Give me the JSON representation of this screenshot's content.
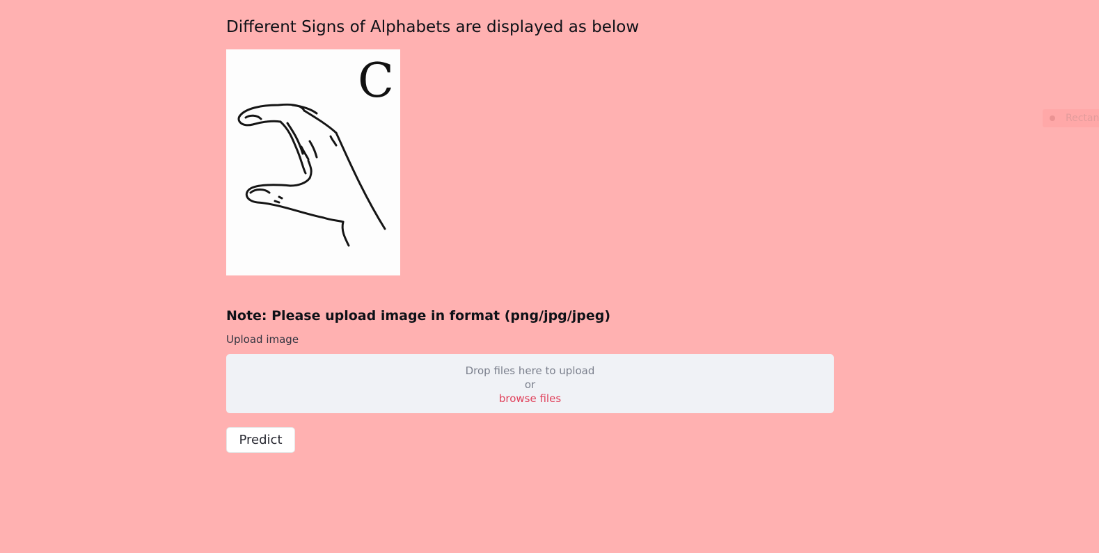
{
  "main": {
    "heading": "Different Signs of Alphabets are displayed as below",
    "sign_image": {
      "letter": "C",
      "icon": "hand-sign-c-illustration"
    },
    "note": "Note: Please upload image in format (png/jpg/jpeg)",
    "uploader": {
      "label": "Upload image",
      "drop_text": "Drop files here to upload",
      "or_text": "or",
      "browse_text": "browse files"
    },
    "predict_label": "Predict"
  },
  "side_widget": {
    "label": "Rectan"
  },
  "colors": {
    "background": "#ffb1b1",
    "dropzone": "#f0f2f6",
    "link": "#e0405a"
  }
}
